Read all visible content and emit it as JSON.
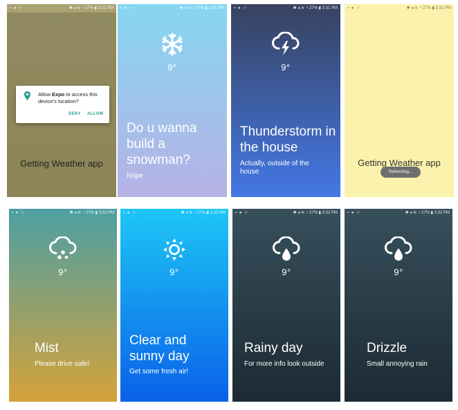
{
  "status": {
    "time_a": "3:31 PM",
    "time_b": "3:32 PM",
    "battery": "27%"
  },
  "screens": [
    {
      "center_text": "Getting Weather app",
      "dialog": {
        "msg_pre": "Allow ",
        "msg_app": "Expo",
        "msg_post": " to access this device's location?",
        "deny": "DENY",
        "allow": "ALLOW"
      }
    },
    {
      "icon": "snowflake-icon",
      "temp": "9°",
      "title": "Do u wanna build a snowman?",
      "subtitle": "Nope"
    },
    {
      "icon": "thunderstorm-icon",
      "temp": "9°",
      "title": "Thunderstorm in the house",
      "subtitle": "Actually, outside of the house"
    },
    {
      "center_text": "Getting Weather app",
      "toast": "Refreshing..."
    },
    {
      "icon": "mist-icon",
      "temp": "9°",
      "title": "Mist",
      "subtitle": "Please drive safe!"
    },
    {
      "icon": "sun-icon",
      "temp": "9°",
      "title": "Clear and sunny day",
      "subtitle": "Get some fresh air!"
    },
    {
      "icon": "rain-icon",
      "temp": "9°",
      "title": "Rainy day",
      "subtitle": "For more info look outside"
    },
    {
      "icon": "drizzle-icon",
      "temp": "9°",
      "title": "Drizzle",
      "subtitle": "Small annoying rain"
    }
  ],
  "colors": {
    "olive": "#c9bf88",
    "sky": "#86d6f2",
    "lavender": "#b6b2e4",
    "navy": "#37425f",
    "blue": "#4478e5",
    "cream": "#fbf3ad",
    "teal": "#4d9fa4",
    "amber": "#d5a239",
    "cyan": "#1ec6f6",
    "royal": "#0a61e8",
    "slate": "#37505c",
    "dark": "#1c2a33"
  }
}
